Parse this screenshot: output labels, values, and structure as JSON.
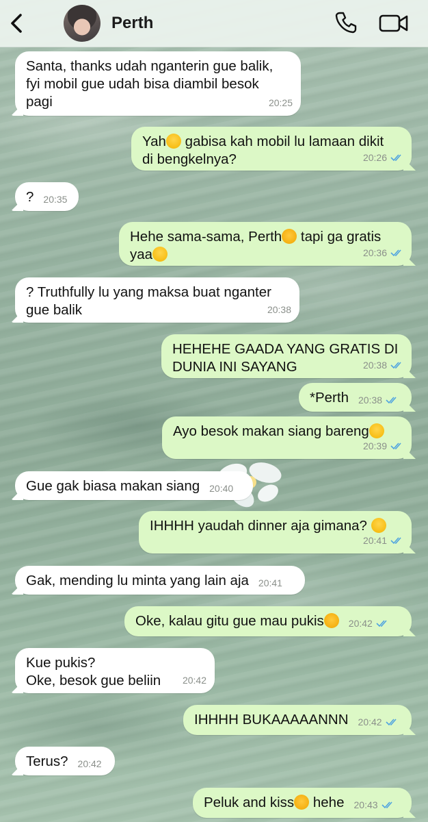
{
  "header": {
    "contact_name": "Perth",
    "back_icon": "chevron-left-icon",
    "call_icon": "phone-icon",
    "video_icon": "video-camera-icon"
  },
  "colors": {
    "incoming_bubble": "#ffffff",
    "outgoing_bubble": "#dcf8c6",
    "read_ticks": "#4fa3e0"
  },
  "messages": [
    {
      "dir": "in",
      "text": "Santa, thanks udah nganterin gue balik, fyi mobil gue udah bisa diambil besok pagi",
      "time": "20:25"
    },
    {
      "dir": "out",
      "text": "Yah😞 gabisa kah mobil lu lamaan dikit di bengkelnya?",
      "time": "20:26",
      "read": true
    },
    {
      "dir": "in",
      "text": "?",
      "time": "20:35"
    },
    {
      "dir": "out",
      "text": "Hehe sama-sama, Perth😽 tapi ga gratis yaa😝",
      "time": "20:36",
      "read": true
    },
    {
      "dir": "in",
      "text": "? Truthfully lu yang maksa buat nganter gue balik",
      "time": "20:38"
    },
    {
      "dir": "out",
      "text": "HEHEHE GAADA YANG GRATIS DI DUNIA INI SAYANG",
      "time": "20:38",
      "read": true
    },
    {
      "dir": "out",
      "text": "*Perth",
      "time": "20:38",
      "read": true
    },
    {
      "dir": "out",
      "text": "Ayo besok makan siang bareng😍",
      "time": "20:39",
      "read": true
    },
    {
      "dir": "in",
      "text": "Gue gak biasa makan siang",
      "time": "20:40"
    },
    {
      "dir": "out",
      "text": "IHHHH yaudah dinner aja gimana? 🥺",
      "time": "20:41",
      "read": true
    },
    {
      "dir": "in",
      "text": "Gak, mending lu minta yang lain aja",
      "time": "20:41"
    },
    {
      "dir": "out",
      "text": "Oke, kalau gitu gue mau pukis😼",
      "time": "20:42",
      "read": true
    },
    {
      "dir": "in",
      "text": "Kue pukis?\nOke, besok gue beliin",
      "time": "20:42"
    },
    {
      "dir": "out",
      "text": "IHHHH BUKAAAAANNN",
      "time": "20:42",
      "read": true
    },
    {
      "dir": "in",
      "text": "Terus?",
      "time": "20:42"
    },
    {
      "dir": "out",
      "text": "Peluk and kiss😽 hehe",
      "time": "20:43",
      "read": true
    }
  ]
}
